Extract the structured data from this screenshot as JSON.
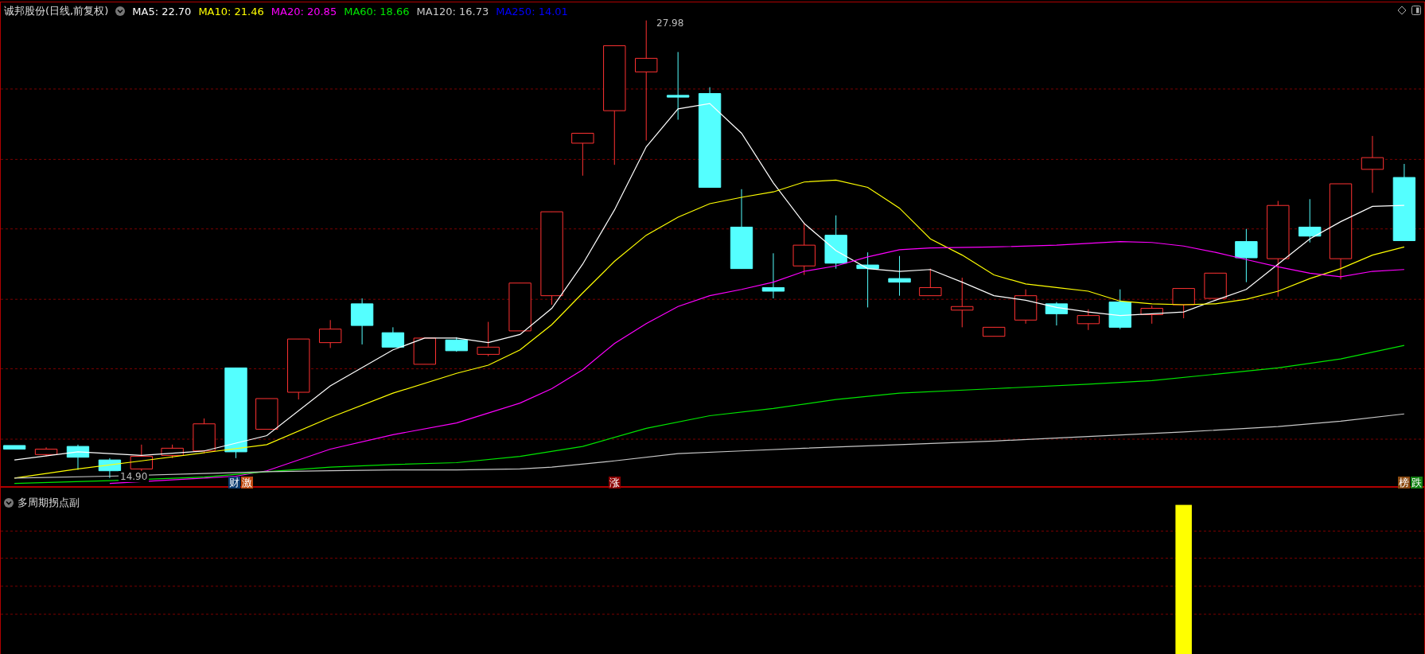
{
  "main_chart": {
    "title": "诚邦股份(日线,前复权)",
    "ma_legend": [
      {
        "label": "MA5: 22.70",
        "color": "#ffffff"
      },
      {
        "label": "MA10: 21.46",
        "color": "#ffff00"
      },
      {
        "label": "MA20: 20.85",
        "color": "#ff00ff"
      },
      {
        "label": "MA60: 18.66",
        "color": "#00e600"
      },
      {
        "label": "MA120: 16.73",
        "color": "#c8c8c8"
      },
      {
        "label": "MA250: 14.01",
        "color": "#0000ff"
      }
    ],
    "high_label": "27.98",
    "low_label": "14.90",
    "markers": [
      {
        "text": "财",
        "color": "#0b3a6e"
      },
      {
        "text": "激",
        "color": "#c04a10"
      },
      {
        "text": "涨",
        "color": "#8b0000"
      },
      {
        "text": "榜",
        "color": "#8b4a10"
      },
      {
        "text": "跌",
        "color": "#108010"
      }
    ]
  },
  "sub_panel": {
    "title": "多周期拐点副"
  }
}
